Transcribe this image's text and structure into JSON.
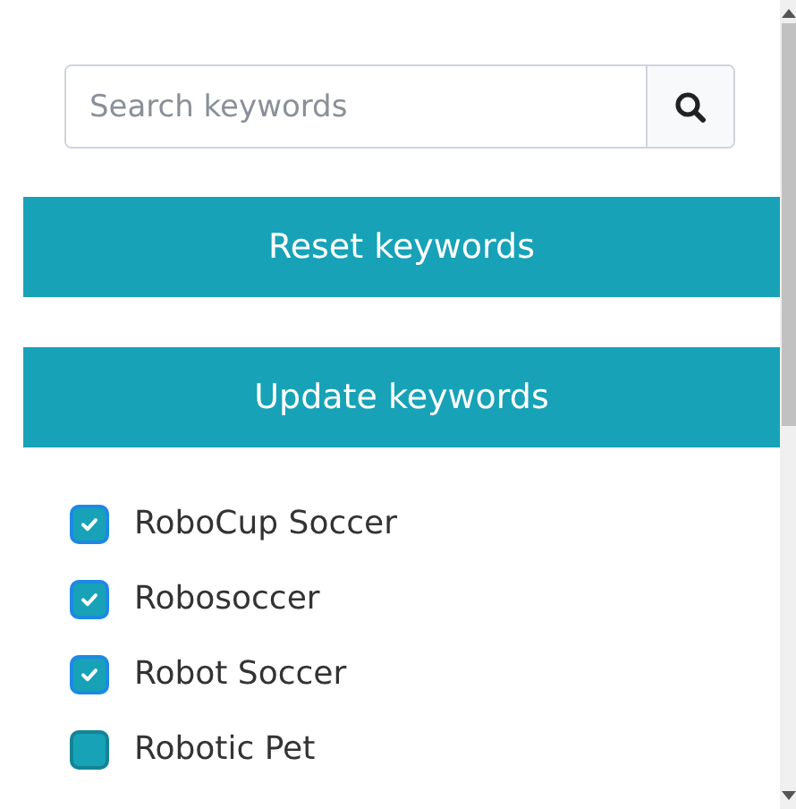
{
  "search": {
    "placeholder": "Search keywords"
  },
  "buttons": [
    "Reset keywords",
    "Update keywords"
  ],
  "keywords": [
    {
      "label": "RoboCup Soccer",
      "checked": true
    },
    {
      "label": "Robosoccer",
      "checked": true
    },
    {
      "label": "Robot Soccer",
      "checked": true
    },
    {
      "label": "Robotic Pet",
      "checked": false
    }
  ]
}
